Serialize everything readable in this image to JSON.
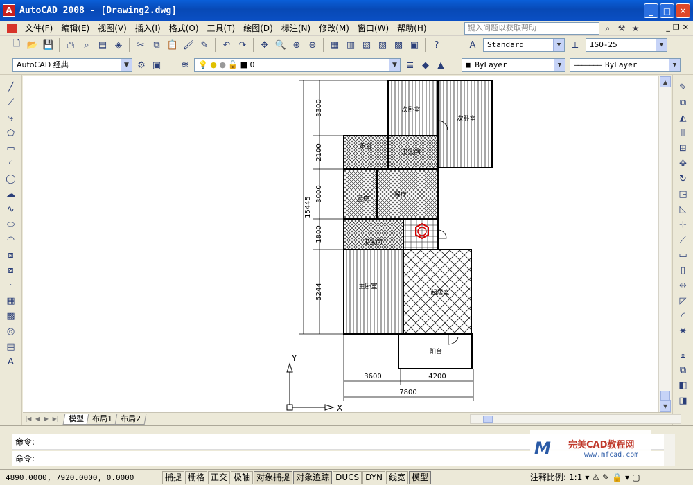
{
  "window": {
    "title": "AutoCAD 2008 - [Drawing2.dwg]",
    "app_icon_glyph": "A"
  },
  "menubar": {
    "items": [
      "文件(F)",
      "编辑(E)",
      "视图(V)",
      "插入(I)",
      "格式(O)",
      "工具(T)",
      "绘图(D)",
      "标注(N)",
      "修改(M)",
      "窗口(W)",
      "帮助(H)"
    ],
    "help_placeholder": "键入问题以获取帮助"
  },
  "toolbar1": {
    "text_style": "Standard",
    "dim_style": "ISO-25"
  },
  "toolbar2": {
    "workspace": "AutoCAD 经典",
    "layer": "0",
    "color": "ByLayer",
    "linetype": "ByLayer"
  },
  "drawing": {
    "dimensions_left": [
      "3300",
      "2100",
      "3000",
      "1800",
      "5244"
    ],
    "dimension_total": "15445",
    "dimensions_bottom": [
      "3600",
      "4200"
    ],
    "dimension_bottom_total": "7800",
    "rooms": {
      "room_top_left": "次卧室",
      "room_top_right": "次卧室",
      "balcony_upper": "阳台",
      "bath_upper": "卫生间",
      "kitchen": "厨房",
      "dining": "餐厅",
      "bath_lower": "卫生间",
      "master_bedroom": "主卧室",
      "living_room": "起居室",
      "balcony_lower": "阳台"
    },
    "ucs": {
      "x_label": "X",
      "y_label": "Y"
    }
  },
  "layout_tabs": [
    "模型",
    "布局1",
    "布局2"
  ],
  "command": {
    "prompt1": "命令:",
    "prompt2": "命令:"
  },
  "watermark": {
    "logo": "M",
    "title": "完美CAD教程网",
    "url": "www.mfcad.com"
  },
  "statusbar": {
    "coords": "4890.0000, 7920.0000, 0.0000",
    "toggles": [
      "捕捉",
      "栅格",
      "正交",
      "极轴",
      "对象捕捉",
      "对象追踪",
      "DUCS",
      "DYN",
      "线宽",
      "模型"
    ],
    "annotation_scale_label": "注释比例:",
    "annotation_scale_value": "1:1"
  },
  "colors": {
    "titlebar": "#0a4fc4",
    "close_button": "#e0482a",
    "accent_red": "#d7342a"
  }
}
